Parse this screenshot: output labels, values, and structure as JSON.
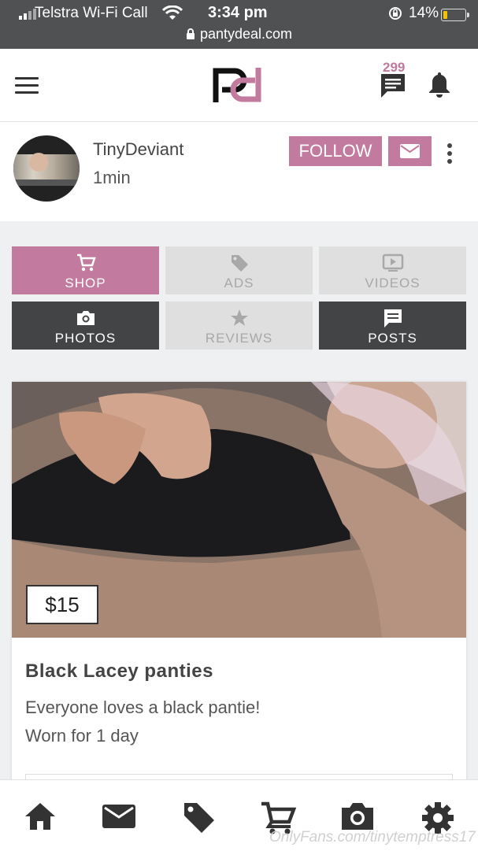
{
  "status_bar": {
    "carrier": "Telstra Wi-Fi Call",
    "time": "3:34 pm",
    "battery": "14%",
    "battery_level": 0.14,
    "url": "pantydeal.com"
  },
  "header": {
    "logo_icon": "pd-logo",
    "message_count": "299"
  },
  "profile": {
    "username": "TinyDeviant",
    "posted": "1min",
    "follow_label": "FOLLOW"
  },
  "tabs": [
    {
      "label": "SHOP",
      "icon": "cart-icon",
      "state": "active"
    },
    {
      "label": "ADS",
      "icon": "tag-icon",
      "state": "disabled"
    },
    {
      "label": "VIDEOS",
      "icon": "video-icon",
      "state": "disabled"
    },
    {
      "label": "PHOTOS",
      "icon": "camera-icon",
      "state": "enabled"
    },
    {
      "label": "REVIEWS",
      "icon": "star-icon",
      "state": "disabled"
    },
    {
      "label": "POSTS",
      "icon": "posts-icon",
      "state": "enabled"
    }
  ],
  "listing": {
    "price": "$15",
    "title": "Black Lacey panties",
    "description_lines": [
      "Everyone loves a black pantie!",
      "Worn for 1 day"
    ]
  },
  "bottom_nav": [
    "home-icon",
    "mail-icon",
    "tag-icon",
    "cart-icon",
    "camera-icon",
    "settings-icon"
  ],
  "watermark": "OnlyFans.com/tinytemptress17",
  "colors": {
    "accent": "#c27b9e",
    "dark_tile": "#434446",
    "grey_tile": "#dfdfdf",
    "status_bar": "#4f5152"
  }
}
